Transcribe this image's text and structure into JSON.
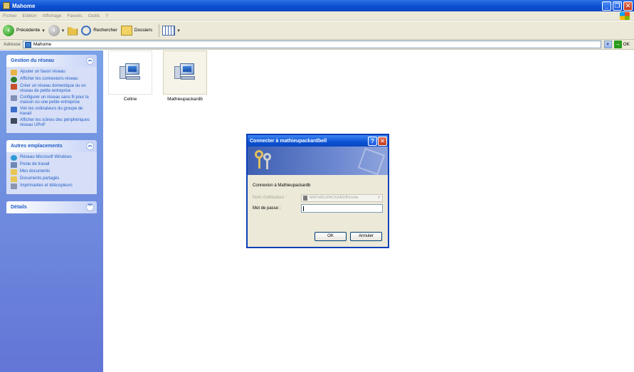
{
  "window": {
    "title": "Mahome"
  },
  "menu": [
    "Fichier",
    "Edition",
    "Affichage",
    "Favoris",
    "Outils",
    "?"
  ],
  "toolbar": {
    "back_label": "Précédente",
    "search_label": "Rechercher",
    "folders_label": "Dossiers"
  },
  "address": {
    "label": "Adresse",
    "value": "Mahome",
    "go_label": "OK"
  },
  "left_pane": {
    "network_tasks": {
      "title": "Gestion du réseau",
      "items": [
        "Ajouter un favori réseau",
        "Afficher les connexions réseau",
        "Créer un réseau domestique ou un réseau de petite entreprise",
        "Configurer un réseau sans fil pour la maison ou une petite entreprise",
        "Voir les ordinateurs du groupe de travail",
        "Afficher les icônes des périphériques réseau UPnP"
      ]
    },
    "other_places": {
      "title": "Autres emplacements",
      "items": [
        "Réseau Microsoft Windows",
        "Poste de travail",
        "Mes documents",
        "Documents partagés",
        "Imprimantes et télécopieurs"
      ]
    },
    "details": {
      "title": "Détails"
    }
  },
  "content": {
    "items": [
      {
        "label": "Celine"
      },
      {
        "label": "Mathieupackardb"
      }
    ]
  },
  "dialog": {
    "title": "Connecter à mathieupackardbell",
    "connecting_text": "Connexion à Mathieupackardb",
    "username_label": "Nom d'utilisateur :",
    "username_value": "MATHIEUPACKARDB\\Invite",
    "password_label": "Mot de passe :",
    "ok_label": "OK",
    "cancel_label": "Annuler"
  }
}
